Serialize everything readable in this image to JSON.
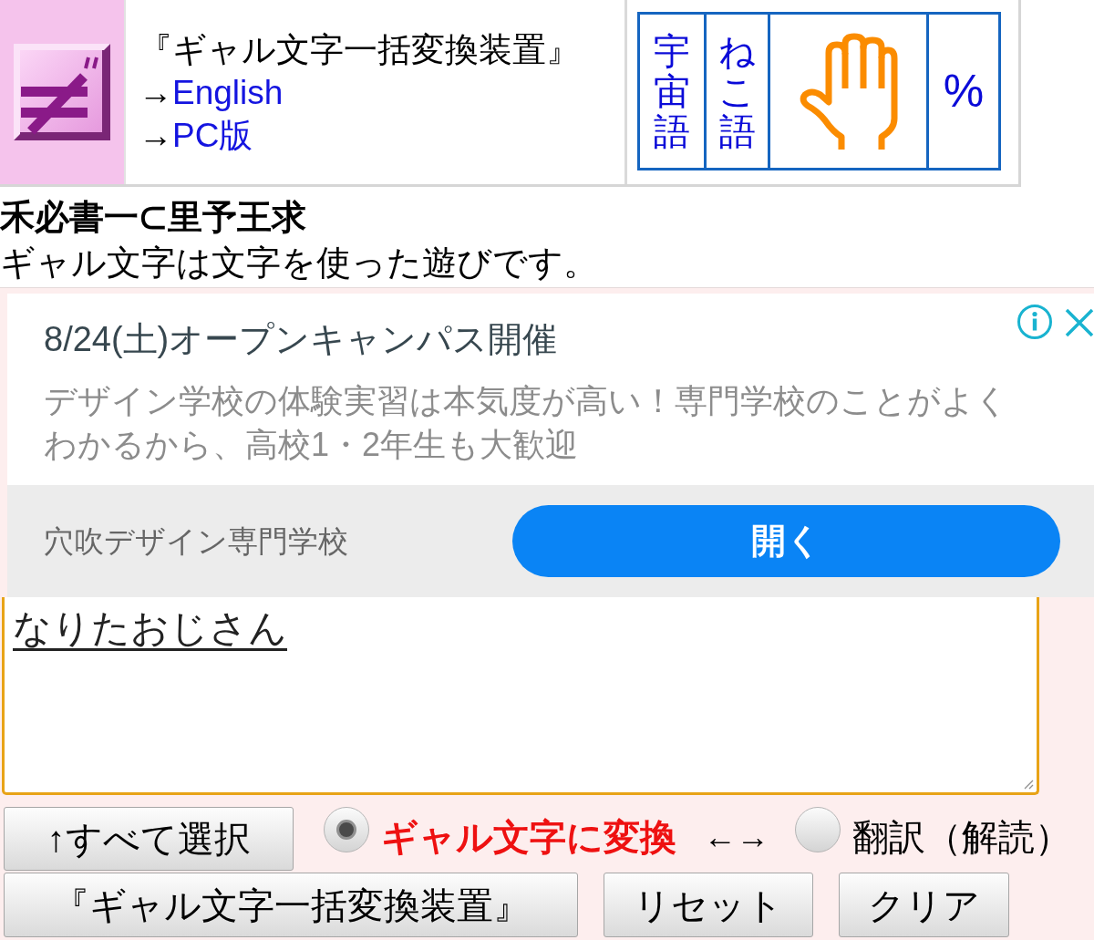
{
  "header": {
    "title": "『ギャル文字一括変換装置』",
    "links": [
      {
        "arrow": "→",
        "label": "English"
      },
      {
        "arrow": "→",
        "label": "PC版"
      }
    ],
    "tiles": [
      {
        "kind": "vertical",
        "label": "宇宙語"
      },
      {
        "kind": "vertical",
        "label": "ねこ語"
      },
      {
        "kind": "icon"
      },
      {
        "kind": "symbol",
        "label": "%"
      }
    ]
  },
  "intro": {
    "heading": "禾必書一⊂里予王求",
    "text": "ギャル文字は文字を使った遊びです。"
  },
  "ad": {
    "title": "8/24(土)オープンキャンパス開催",
    "description": "デザイン学校の体験実習は本気度が高い！専門学校のことがよくわかるから、高校1・2年生も大歓迎",
    "advertiser": "穴吹デザイン専門学校",
    "button": "開く"
  },
  "editor": {
    "value": "なりたおじさん"
  },
  "controls": {
    "select_all": "↑すべて選択",
    "modes": [
      {
        "label": "ギャル文字に変換",
        "selected": true
      },
      {
        "label": "翻訳（解読）",
        "selected": false
      }
    ],
    "separator": "←→",
    "buttons": [
      "『ギャル文字一括変換装置』",
      "リセット",
      "クリア"
    ]
  }
}
